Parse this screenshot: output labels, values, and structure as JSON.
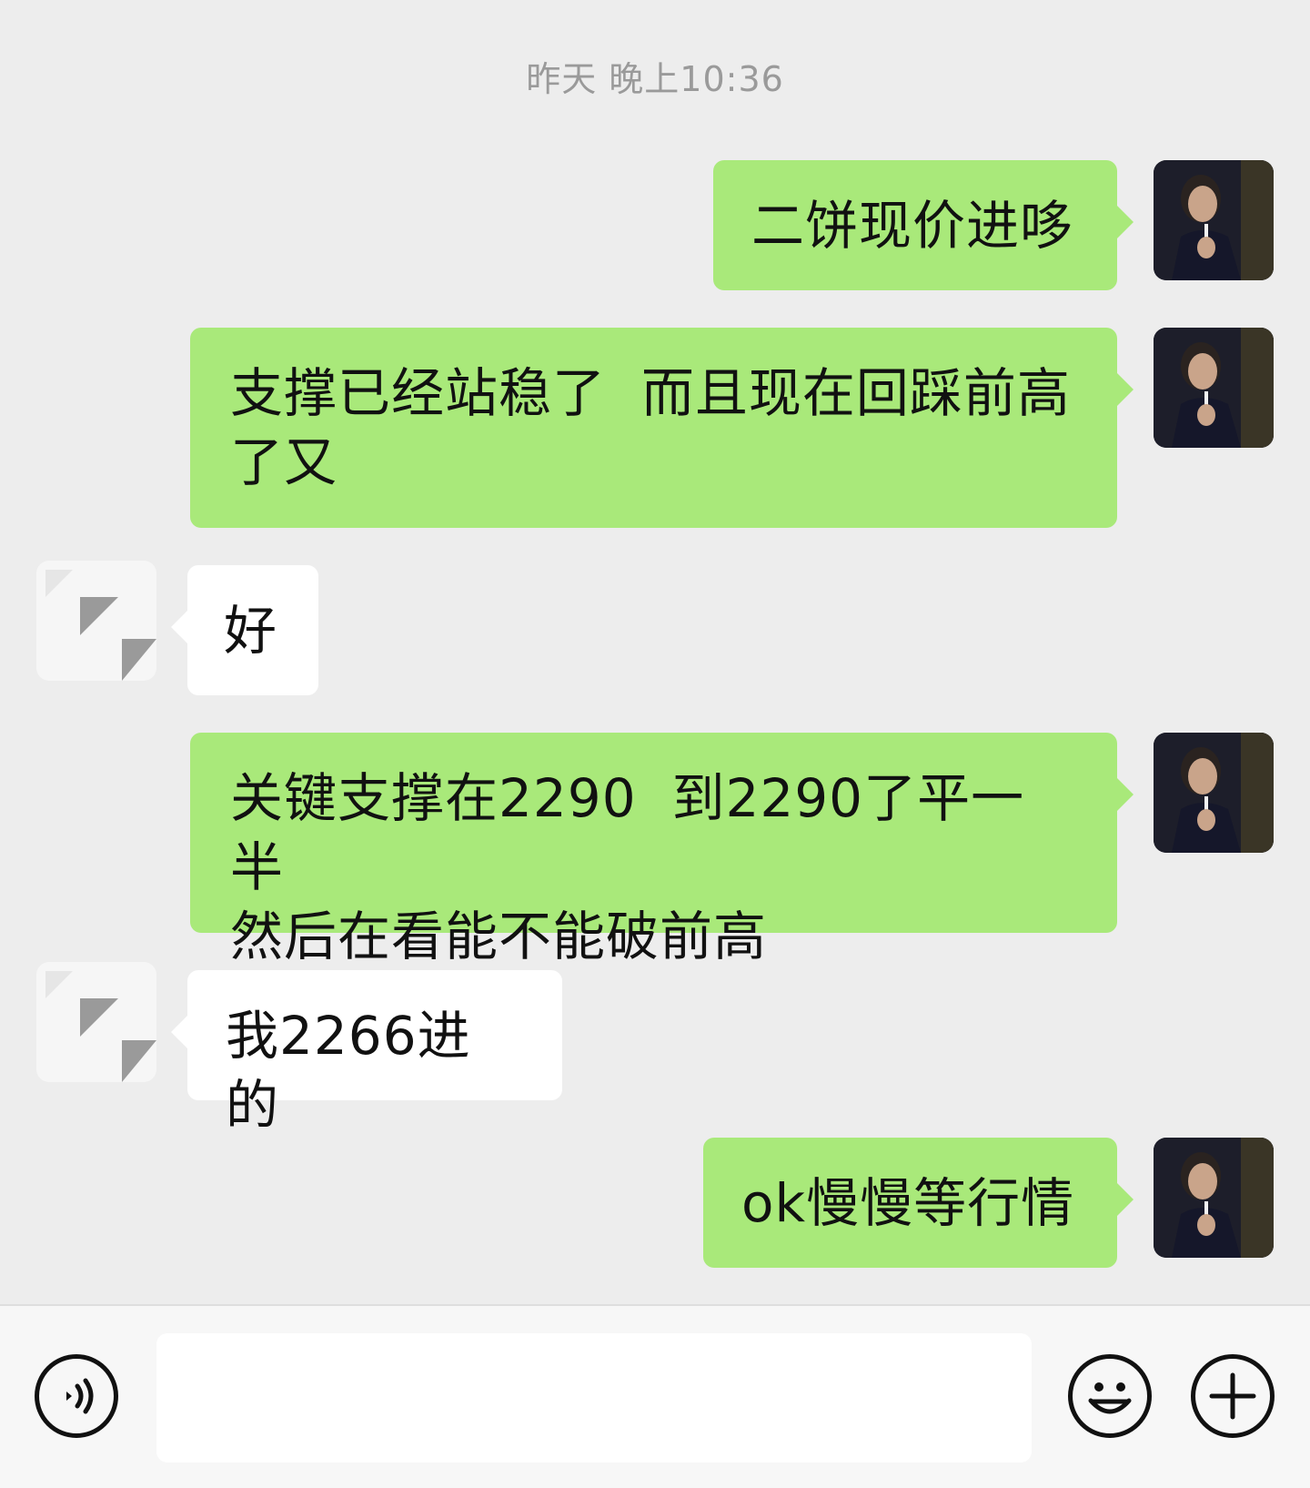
{
  "timestamp": "昨天 晚上10:36",
  "messages": [
    {
      "sender": "self",
      "text": "二饼现价进哆"
    },
    {
      "sender": "self",
      "text": "支撑已经站稳了  而且现在回踩前高\n了又"
    },
    {
      "sender": "other",
      "text": "好"
    },
    {
      "sender": "self",
      "text": "关键支撑在2290  到2290了平一半\n然后在看能不能破前高"
    },
    {
      "sender": "other",
      "text": "我2266进的"
    },
    {
      "sender": "self",
      "text": "ok慢慢等行情"
    }
  ],
  "input": {
    "value": "",
    "placeholder": ""
  },
  "toolbar": {
    "voice_icon": "voice-icon",
    "emoji_icon": "emoji-icon",
    "plus_icon": "plus-icon"
  },
  "colors": {
    "background": "#ededed",
    "self_bubble": "#a9e97a",
    "other_bubble": "#ffffff",
    "timestamp": "#9a9a9a"
  }
}
